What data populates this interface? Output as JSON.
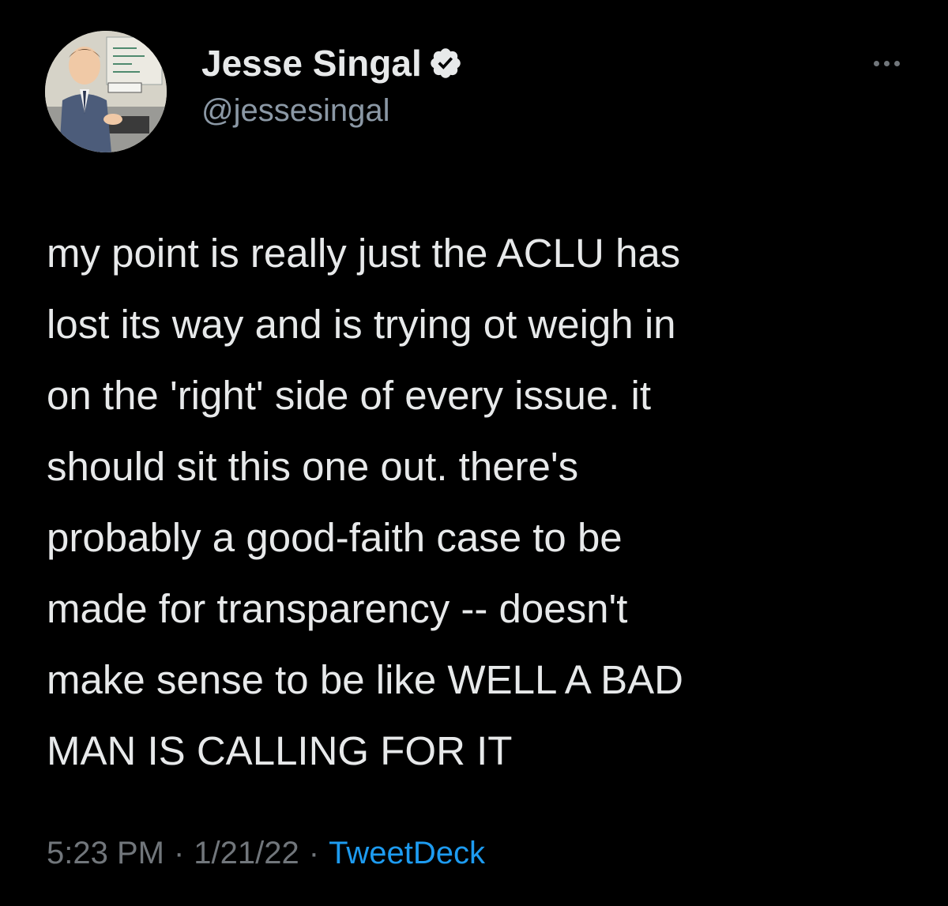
{
  "author": {
    "display_name": "Jesse Singal",
    "handle": "@jessesingal",
    "verified": true,
    "avatar_icon": "cartoon-avatar-icon",
    "verified_icon": "verified-badge-icon"
  },
  "more_icon": "more-horizontal-icon",
  "tweet": {
    "lines": [
      "my point is really just the ACLU has",
      "lost its way and is trying ot weigh in",
      "on the 'right' side of every issue. it",
      "should sit this one out. there's",
      "probably a good-faith case to be",
      "made for transparency -- doesn't",
      "make sense to be like WELL A BAD",
      "MAN IS CALLING FOR IT"
    ],
    "time": "5:23 PM",
    "date": "1/21/22",
    "separator": "·",
    "source": "TweetDeck"
  },
  "colors": {
    "background": "#000000",
    "text_primary": "#e7e9ea",
    "text_secondary": "#71767b",
    "link": "#1d9bf0"
  }
}
